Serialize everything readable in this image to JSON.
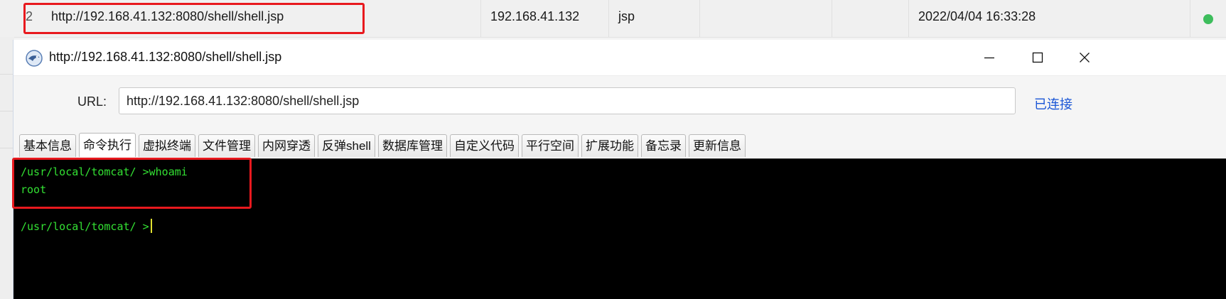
{
  "list_row": {
    "index": "2",
    "url": "http://192.168.41.132:8080/shell/shell.jsp",
    "ip": "192.168.41.132",
    "type": "jsp",
    "time": "2022/04/04 16:33:28",
    "status_color": "#3dbd5c"
  },
  "window": {
    "title": "http://192.168.41.132:8080/shell/shell.jsp",
    "controls": {
      "minimize": "minimize-icon",
      "maximize": "maximize-icon",
      "close": "close-icon"
    }
  },
  "urlbar": {
    "label": "URL:",
    "value": "http://192.168.41.132:8080/shell/shell.jsp",
    "status": "已连接"
  },
  "tabs": [
    {
      "label": "基本信息",
      "active": false
    },
    {
      "label": "命令执行",
      "active": true
    },
    {
      "label": "虚拟终端",
      "active": false
    },
    {
      "label": "文件管理",
      "active": false
    },
    {
      "label": "内网穿透",
      "active": false
    },
    {
      "label": "反弹shell",
      "active": false
    },
    {
      "label": "数据库管理",
      "active": false
    },
    {
      "label": "自定义代码",
      "active": false
    },
    {
      "label": "平行空间",
      "active": false
    },
    {
      "label": "扩展功能",
      "active": false
    },
    {
      "label": "备忘录",
      "active": false
    },
    {
      "label": "更新信息",
      "active": false
    }
  ],
  "terminal": {
    "lines": [
      "/usr/local/tomcat/ >whoami",
      "root",
      "",
      "/usr/local/tomcat/ >"
    ],
    "text_color": "#33e033"
  },
  "accent": {
    "highlight": "#e8191e",
    "link": "#1a56d6"
  }
}
